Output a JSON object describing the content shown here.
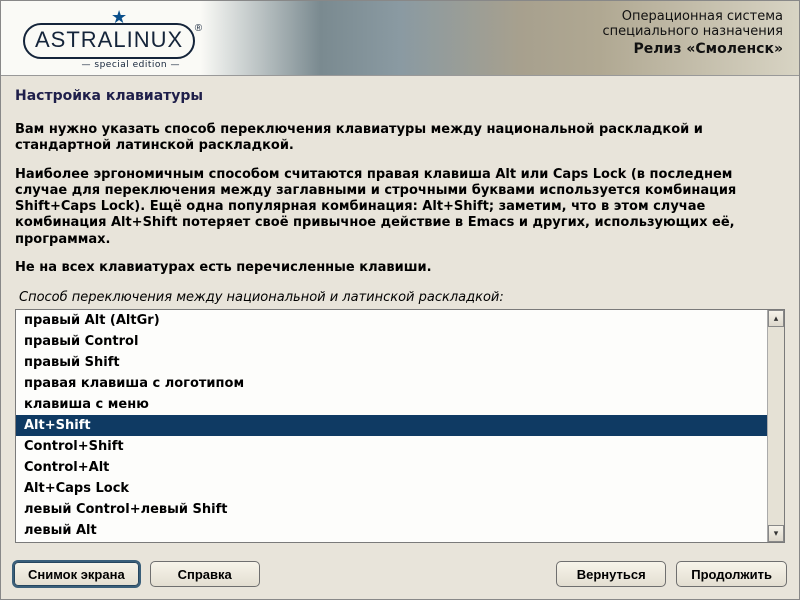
{
  "banner": {
    "logo_word": "ASTRALINUX",
    "logo_sub": "— special edition —",
    "right1": "Операционная система",
    "right2": "специального назначения",
    "right3": "Релиз «Смоленск»"
  },
  "title": "Настройка клавиатуры",
  "para1": "Вам нужно указать способ переключения клавиатуры между национальной раскладкой и стандартной латинской раскладкой.",
  "para2": "Наиболее эргономичным способом считаются правая клавиша Alt или Caps Lock (в последнем случае для переключения между заглавными и строчными буквами используется комбинация Shift+Caps Lock). Ещё одна популярная комбинация: Alt+Shift; заметим, что в этом случае комбинация Alt+Shift потеряет своё привычное действие в Emacs и других, использующих её, программах.",
  "para3": "Не на всех клавиатурах есть перечисленные клавиши.",
  "prompt": "Способ переключения между национальной и латинской раскладкой:",
  "options": [
    "правый Alt (AltGr)",
    "правый Control",
    "правый Shift",
    "правая клавиша с логотипом",
    "клавиша с меню",
    "Alt+Shift",
    "Control+Shift",
    "Control+Alt",
    "Alt+Caps Lock",
    "левый Control+левый Shift",
    "левый Alt"
  ],
  "selected_index": 5,
  "buttons": {
    "screenshot": "Снимок экрана",
    "help": "Справка",
    "back": "Вернуться",
    "continue": "Продолжить"
  }
}
